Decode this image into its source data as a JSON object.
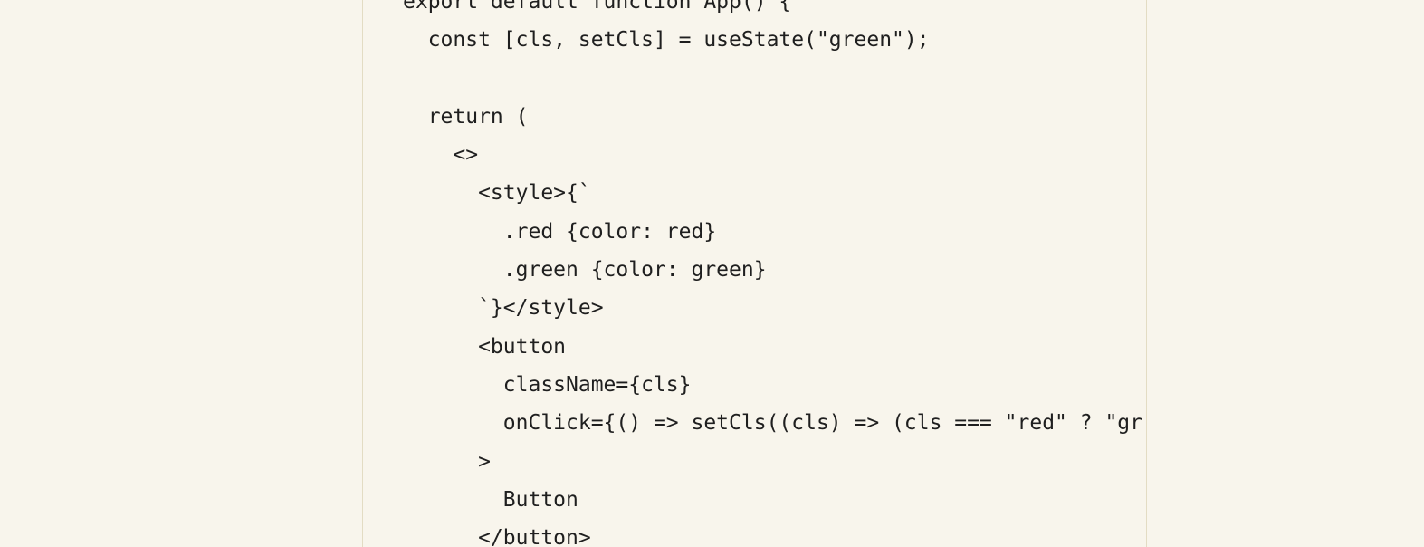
{
  "code": {
    "lines": [
      "export default function App() {",
      "  const [cls, setCls] = useState(\"green\");",
      "",
      "  return (",
      "    <>",
      "      <style>{`",
      "        .red {color: red}",
      "        .green {color: green}",
      "      `}</style>",
      "      <button",
      "        className={cls}",
      "        onClick={() => setCls((cls) => (cls === \"red\" ? \"gr",
      "      >",
      "        Button",
      "      </button>"
    ]
  },
  "colors": {
    "background": "#f8f5ec",
    "text": "#1f1f1f",
    "border": "#e3dcc3"
  }
}
